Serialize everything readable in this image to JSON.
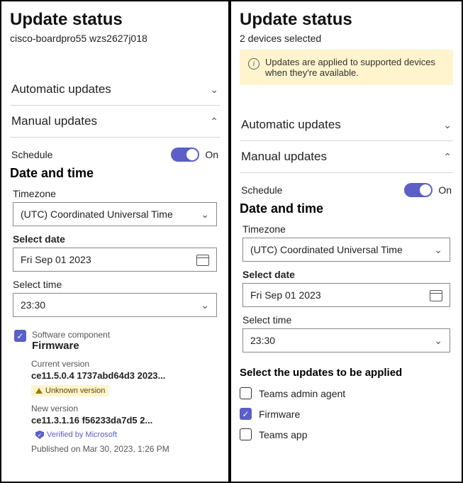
{
  "left": {
    "title": "Update status",
    "subtitle": "cisco-boardpro55 wzs2627j018",
    "auto_section": "Automatic updates",
    "manual_section": "Manual updates",
    "schedule_label": "Schedule",
    "schedule_state": "On",
    "dt_head": "Date and time",
    "timezone_label": "Timezone",
    "timezone_value": "(UTC) Coordinated Universal Time",
    "date_label": "Select date",
    "date_value": "Fri Sep 01 2023",
    "time_label": "Select time",
    "time_value": "23:30",
    "sc_label": "Software component",
    "sc_value": "Firmware",
    "cur_label": "Current version",
    "cur_value": "ce11.5.0.4 1737abd64d3 2023...",
    "cur_tag": "Unknown version",
    "new_label": "New version",
    "new_value": "ce11.3.1.16 f56233da7d5 2...",
    "new_tag": "Verified by Microsoft",
    "pub": "Published on Mar 30, 2023, 1:26 PM"
  },
  "right": {
    "title": "Update status",
    "subtitle": "2 devices selected",
    "notice": "Updates are applied to supported devices when they're available.",
    "auto_section": "Automatic updates",
    "manual_section": "Manual updates",
    "schedule_label": "Schedule",
    "schedule_state": "On",
    "dt_head": "Date and time",
    "timezone_label": "Timezone",
    "timezone_value": "(UTC) Coordinated Universal Time",
    "date_label": "Select date",
    "date_value": "Fri Sep 01 2023",
    "time_label": "Select time",
    "time_value": "23:30",
    "select_head": "Select the updates to be applied",
    "opts": {
      "teams_agent": "Teams admin agent",
      "firmware": "Firmware",
      "teams_app": "Teams app"
    }
  }
}
